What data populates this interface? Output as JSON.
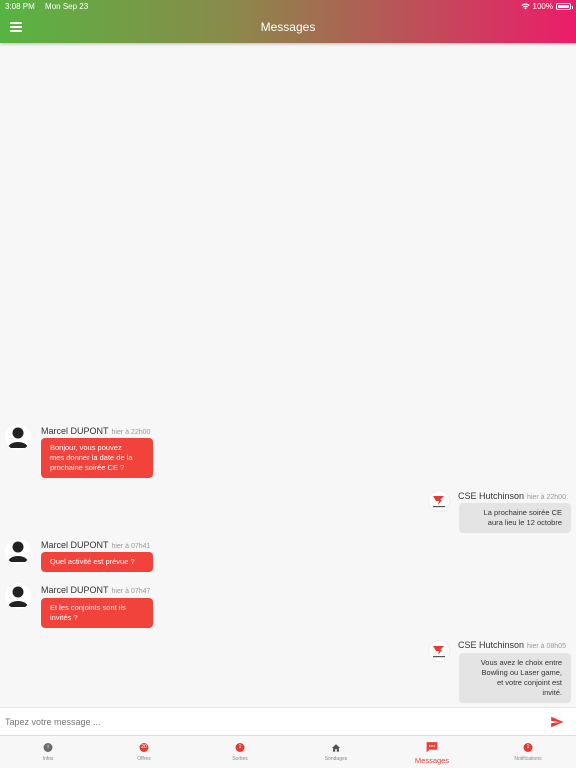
{
  "status": {
    "time": "3:08 PM",
    "date": "Mon Sep 23",
    "battery": "100%"
  },
  "header": {
    "title": "Messages"
  },
  "messages": [
    {
      "author": "Marcel DUPONT",
      "time": "hier à 22h00",
      "text": [
        "Bonjour, vous pouvez",
        "mes donner la date de la",
        "prochaine soirée CE ?"
      ]
    },
    {
      "author": "CSE Hutchinson",
      "time": "hier à 22h00",
      "text": [
        "La prochaine soirée CE",
        "aura lieu le 12 octobre"
      ]
    },
    {
      "author": "Marcel DUPONT",
      "time": "hier à 07h41",
      "text": [
        "Quel activité est prévue ?"
      ]
    },
    {
      "author": "Marcel DUPONT",
      "time": "hier à 07h47",
      "text": [
        "Et les conjoints sont ils",
        "invités ?"
      ]
    },
    {
      "author": "CSE Hutchinson",
      "time": "hier à 08h05",
      "text": [
        "Vous avez le choix entre",
        "Bowling ou Laser game,",
        "et votre conjoint est",
        "invité."
      ]
    }
  ],
  "composer": {
    "placeholder": "Tapez votre message ..."
  },
  "tabs": [
    {
      "label": "Infos",
      "icon": "info-icon"
    },
    {
      "label": "Offres",
      "icon": "offers-badge",
      "badge": "20"
    },
    {
      "label": "Sorties",
      "icon": "outings-badge",
      "badge": "1"
    },
    {
      "label": "Sondages",
      "icon": "home-icon"
    },
    {
      "label": "Messages",
      "icon": "chat-icon"
    },
    {
      "label": "Notifications",
      "icon": "notifications-badge",
      "badge": "1"
    }
  ],
  "colors": {
    "accent": "#f1433b",
    "bubble_in": "#e4e4e4",
    "gradient_start": "#58b442",
    "gradient_end": "#ec1c6a"
  }
}
